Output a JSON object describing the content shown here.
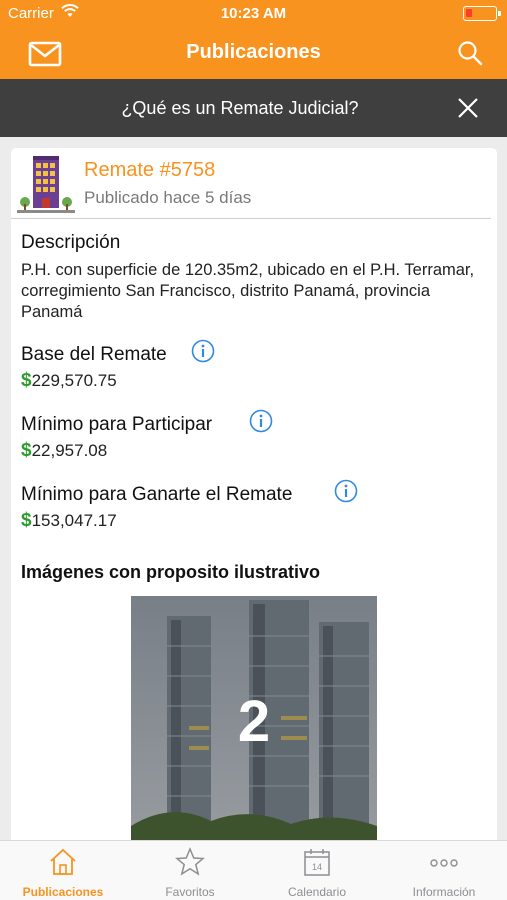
{
  "status_bar": {
    "carrier": "Carrier",
    "time": "10:23 AM",
    "battery_level": 0.2
  },
  "nav": {
    "title": "Publicaciones"
  },
  "banner": {
    "text": "¿Qué es un Remate Judicial?"
  },
  "auction": {
    "title": "Remate #5758",
    "posted": "Publicado hace 5 días",
    "description_heading": "Descripción",
    "description": "P.H. con superficie de 120.35m2, ubicado en el P.H. Terramar, corregimiento San Francisco, distrito Panamá, provincia Panamá",
    "base_heading": "Base del Remate",
    "base_value": "229,570.75",
    "min_participate_heading": "Mínimo para Participar",
    "min_participate_value": "22,957.08",
    "min_win_heading": "Mínimo para Ganarte el Remate",
    "min_win_value": "153,047.17",
    "currency_symbol": "$",
    "images_heading": "Imágenes con proposito ilustrativo",
    "image_counter": "2"
  },
  "tabbar": {
    "items": [
      {
        "label": "Publicaciones",
        "icon": "house-icon",
        "active": true
      },
      {
        "label": "Favoritos",
        "icon": "star-icon",
        "active": false
      },
      {
        "label": "Calendario",
        "icon": "calendar-icon",
        "active": false,
        "calendar_day": "14"
      },
      {
        "label": "Información",
        "icon": "more-dots-icon",
        "active": false
      }
    ]
  },
  "colors": {
    "accent": "#f7931e",
    "banner": "#3f3f3f",
    "money_green": "#2e9b2e",
    "info_blue": "#2f8ae0"
  }
}
